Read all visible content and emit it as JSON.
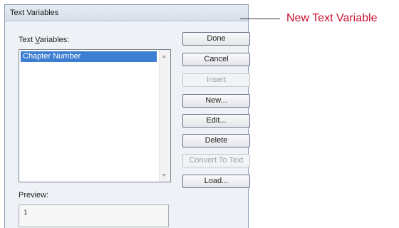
{
  "dialog": {
    "title": "Text Variables",
    "list_label_before": "Text ",
    "list_label_underline": "V",
    "list_label_after": "ariables:",
    "items": [
      "Chapter Number"
    ],
    "preview_label": "Preview:",
    "preview_value": "1"
  },
  "buttons": {
    "done": "Done",
    "cancel": "Cancel",
    "insert": "Insert",
    "new": "New...",
    "edit": "Edit...",
    "delete": "Delete",
    "convert": "Convert To Text",
    "load": "Load..."
  },
  "callout": {
    "label": "New Text Variable",
    "color": "#c8102e"
  },
  "colors": {
    "selection": "#3c7fd2",
    "dialog_bg": "#eef1f6"
  }
}
